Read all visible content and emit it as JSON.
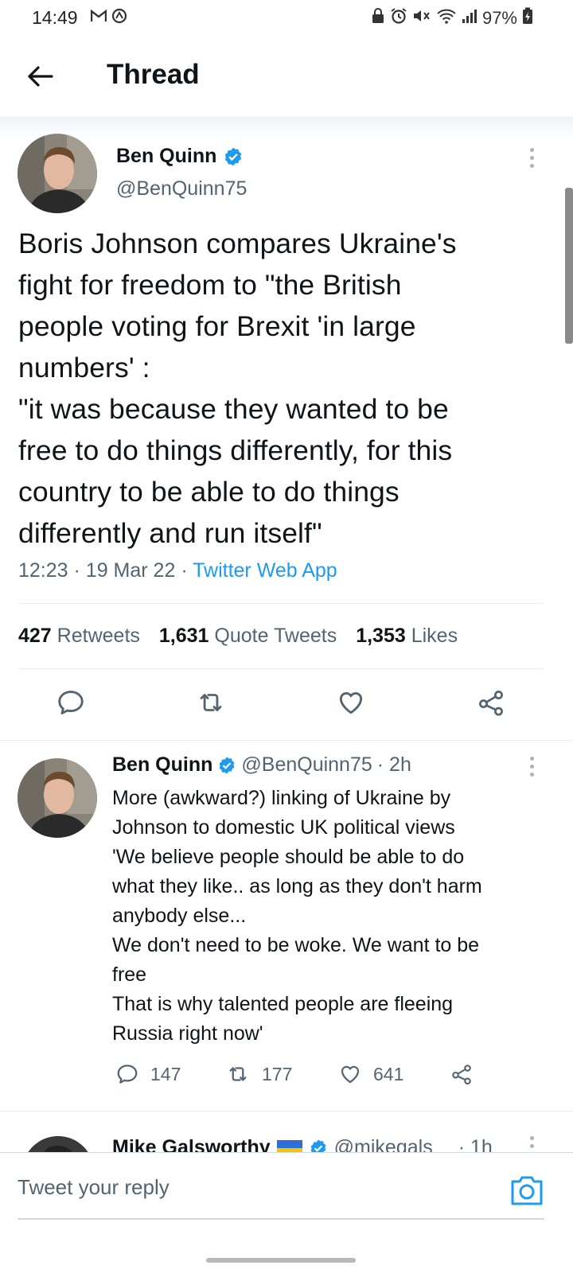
{
  "status_bar": {
    "time": "14:49",
    "battery": "97%"
  },
  "header": {
    "title": "Thread"
  },
  "main_tweet": {
    "name": "Ben Quinn",
    "handle": "@BenQuinn75",
    "text_lines": [
      "Boris Johnson compares Ukraine's",
      "fight for freedom to \"the British",
      "people voting for Brexit 'in large",
      "numbers' :",
      "\"it was because they wanted to be",
      "free to do things differently, for this",
      "country to be able to do things",
      "differently and run itself\""
    ],
    "time": "12:23",
    "date": "19 Mar 22",
    "source": "Twitter Web App",
    "stats": {
      "retweets_count": "427",
      "retweets_label": "Retweets",
      "quotes_count": "1,631",
      "quotes_label": "Quote Tweets",
      "likes_count": "1,353",
      "likes_label": "Likes"
    }
  },
  "reply_tweet": {
    "name": "Ben Quinn",
    "handle": "@BenQuinn75",
    "age": "· 2h",
    "text_lines": [
      "More (awkward?) linking of Ukraine by",
      "Johnson to domestic UK political views",
      "'We believe people should be able to do",
      "what they like.. as long as they don't harm",
      "anybody else...",
      "We don't need to be woke. We want to be",
      "free",
      "That is why talented people are fleeing",
      "Russia right now'"
    ],
    "reply_count": "147",
    "retweet_count": "177",
    "like_count": "641"
  },
  "next_tweet": {
    "name": "Mike Galsworthy",
    "handle": "@mikegals",
    "age": "· 1h"
  },
  "reply_bar": {
    "placeholder": "Tweet your reply"
  },
  "colors": {
    "accent": "#1d9bf0",
    "secondary_text": "#536471"
  }
}
